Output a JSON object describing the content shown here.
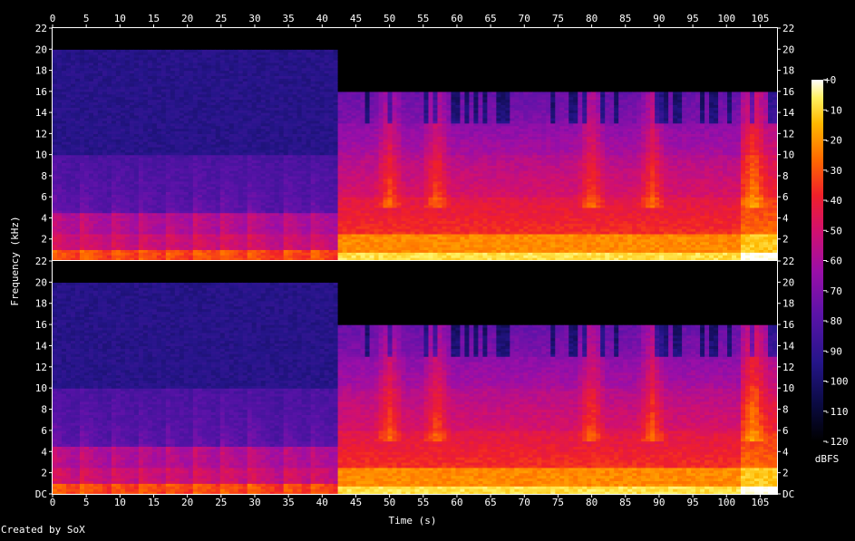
{
  "footer": "Created by SoX",
  "chart_data": {
    "type": "heatmap",
    "xlabel": "Time (s)",
    "ylabel": "Frequency (kHz)",
    "xlim": [
      0,
      107.5
    ],
    "ylim": [
      0,
      22
    ],
    "x_ticks": [
      "0",
      "5",
      "10",
      "15",
      "20",
      "25",
      "30",
      "35",
      "40",
      "45",
      "50",
      "55",
      "60",
      "65",
      "70",
      "75",
      "80",
      "85",
      "90",
      "95",
      "100",
      "105"
    ],
    "y_ticks_top": [
      "22",
      "20",
      "18",
      "16",
      "14",
      "12",
      "10",
      "8",
      "6",
      "4",
      "2"
    ],
    "y_ticks_bottom": [
      "22",
      "20",
      "18",
      "16",
      "14",
      "12",
      "10",
      "8",
      "6",
      "4",
      "2",
      "DC"
    ],
    "channels": 2,
    "colorbar": {
      "label": "dBFS",
      "ticks": [
        "+0",
        "-10",
        "-20",
        "-30",
        "-40",
        "-50",
        "-60",
        "-70",
        "-80",
        "-90",
        "-100",
        "-110",
        "-120"
      ],
      "range": [
        -120,
        0
      ]
    },
    "segments": [
      {
        "start": 0,
        "end": 42.5,
        "cutoff_khz": 20,
        "character": "quiet piano, energy below 4 kHz"
      },
      {
        "start": 42.5,
        "end": 107.5,
        "cutoff_khz": 16,
        "character": "loud full-band, energy up to 16 kHz"
      }
    ]
  }
}
